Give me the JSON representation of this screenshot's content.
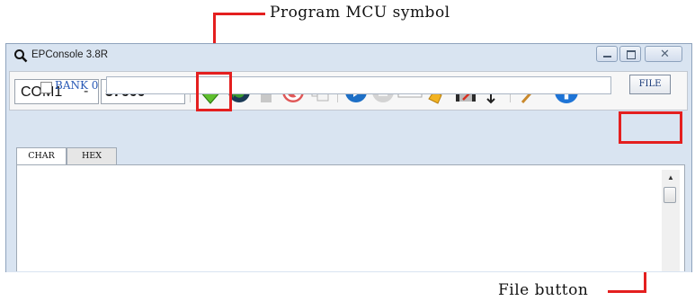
{
  "annotations": {
    "program_mcu": "Program  MCU  symbol",
    "file_button": "File button"
  },
  "window": {
    "title": "EPConsole 3.8R",
    "controls": [
      "minimize",
      "maximize",
      "close"
    ]
  },
  "toolbar": {
    "port": "COM1",
    "baud": "57600",
    "buttons": [
      "program-mcu-icon",
      "refresh-icon",
      "upload-icon",
      "stop-sign-icon",
      "copy-icon",
      "play-icon",
      "stop-icon",
      "console-icon",
      "clear-broom-icon",
      "save-icon",
      "expand-icon",
      "tools-hammer-icon",
      "info-icon"
    ]
  },
  "bank": {
    "label": "BANK 0",
    "path_value": "",
    "file_label": "FILE"
  },
  "tabs": [
    {
      "label": "CHAR",
      "active": true
    },
    {
      "label": "HEX",
      "active": false
    }
  ],
  "colors": {
    "callout": "#e41f1f",
    "title_bg": "#d9e4f1",
    "bank_text": "#2a5ab6"
  }
}
